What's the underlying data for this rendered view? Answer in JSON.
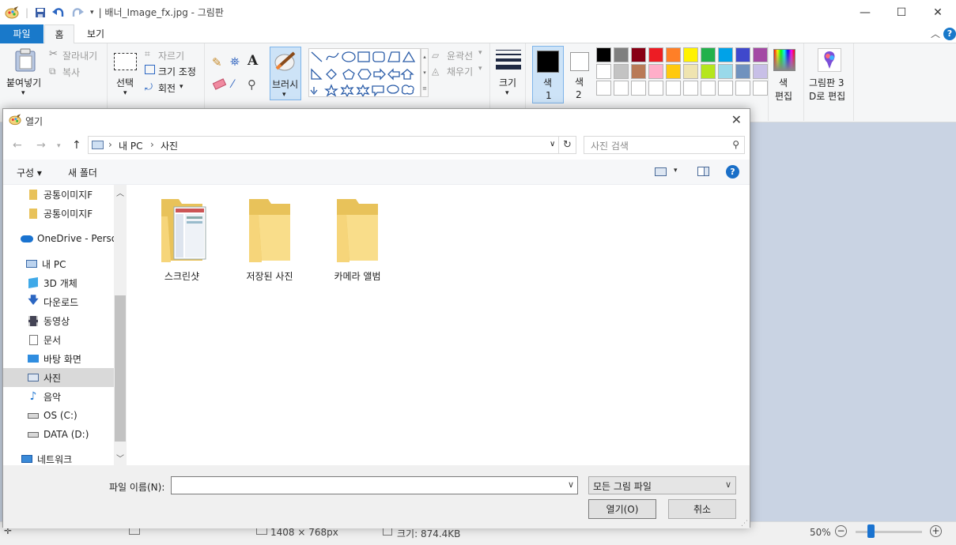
{
  "window": {
    "title": "| 배너_Image_fx.jpg - 그림판",
    "controls": {
      "minimize": "—",
      "maximize": "☐",
      "close": "✕"
    }
  },
  "ribbon": {
    "tabs": [
      {
        "label": "파일"
      },
      {
        "label": "홈"
      },
      {
        "label": "보기"
      }
    ],
    "clipboard": {
      "paste": "붙여넣기",
      "cut": "잘라내기",
      "copy": "복사"
    },
    "image": {
      "select": "선택",
      "crop": "자르기",
      "resize": "크기 조정",
      "rotate": "회전"
    },
    "brush": {
      "label": "브러시"
    },
    "shapes": {
      "outline": "윤곽선",
      "fill": "채우기"
    },
    "size": {
      "label": "크기"
    },
    "color1": {
      "label": "색",
      "num": "1",
      "value": "#000000"
    },
    "color2": {
      "label": "색",
      "num": "2",
      "value": "#ffffff"
    },
    "palette_row1": [
      "#000000",
      "#7f7f7f",
      "#880015",
      "#ed1c24",
      "#ff7f27",
      "#fff200",
      "#22b14c",
      "#00a2e8",
      "#3f48cc",
      "#a349a4"
    ],
    "palette_row2": [
      "#ffffff",
      "#c3c3c3",
      "#b97a57",
      "#ffaec9",
      "#ffc90e",
      "#efe4b0",
      "#b5e61d",
      "#99d9ea",
      "#7092be",
      "#c8bfe7"
    ],
    "edit_colors": {
      "line1": "색",
      "line2": "편집"
    },
    "paint3d": {
      "line1": "그림판 3",
      "line2": "D로 편집"
    }
  },
  "statusbar": {
    "dimensions": "1408 × 768px",
    "filesize": "크기: 874.4KB",
    "zoom": "50%",
    "zoom_minus": "−",
    "zoom_plus": "+"
  },
  "dialog": {
    "title": "열기",
    "close": "✕",
    "address": {
      "segments": [
        "내 PC",
        "사진"
      ],
      "separator": "›"
    },
    "search_placeholder": "사진 검색",
    "toolbar": {
      "organize": "구성 ▾",
      "new_folder": "새 폴더"
    },
    "nav_items": [
      {
        "label": "공통이미지F",
        "icon": "folder-icon"
      },
      {
        "label": "공통이미지F",
        "icon": "folder-icon"
      },
      {
        "label": "OneDrive - Person",
        "icon": "onedrive-cloud-icon"
      },
      {
        "label": "내 PC",
        "icon": "computer-icon"
      },
      {
        "label": "3D 개체",
        "icon": "3d-objects-icon"
      },
      {
        "label": "다운로드",
        "icon": "download-icon"
      },
      {
        "label": "동영상",
        "icon": "video-icon"
      },
      {
        "label": "문서",
        "icon": "document-icon"
      },
      {
        "label": "바탕 화면",
        "icon": "desktop-icon"
      },
      {
        "label": "사진",
        "icon": "pictures-icon",
        "selected": true
      },
      {
        "label": "음악",
        "icon": "music-icon"
      },
      {
        "label": "OS (C:)",
        "icon": "drive-c-icon"
      },
      {
        "label": "DATA (D:)",
        "icon": "drive-d-icon"
      },
      {
        "label": "네트워크",
        "icon": "network-icon"
      }
    ],
    "folders": [
      {
        "label": "스크린샷",
        "icon": "folder-with-preview-icon"
      },
      {
        "label": "저장된 사진",
        "icon": "folder-icon"
      },
      {
        "label": "카메라 앨범",
        "icon": "folder-icon"
      }
    ],
    "filename_label": "파일 이름(N):",
    "filename_value": "",
    "filetype": "모든 그림 파일",
    "open_button": "열기(O)",
    "cancel_button": "취소"
  }
}
